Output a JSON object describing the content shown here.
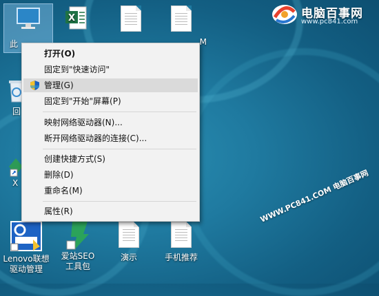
{
  "desktop": {
    "icons": [
      {
        "label": "此"
      },
      {
        "label": ""
      },
      {
        "label": ""
      },
      {
        "label": ""
      },
      {
        "label": "M"
      },
      {
        "label": "回"
      },
      {
        "label": "X"
      },
      {
        "label": "Lenovo联想驱动管理"
      },
      {
        "label": "爱站SEO工具包"
      },
      {
        "label": "演示"
      },
      {
        "label": "手机推荐"
      }
    ]
  },
  "context_menu": {
    "items": [
      {
        "label": "打开(O)",
        "bold": true
      },
      {
        "label": "固定到\"快速访问\""
      },
      {
        "label": "管理(G)",
        "icon": "shield-icon",
        "highlighted": true
      },
      {
        "label": "固定到\"开始\"屏幕(P)"
      },
      {
        "label": "映射网络驱动器(N)..."
      },
      {
        "label": "断开网络驱动器的连接(C)..."
      },
      {
        "label": "创建快捷方式(S)"
      },
      {
        "label": "删除(D)"
      },
      {
        "label": "重命名(M)"
      },
      {
        "label": "属性(R)"
      }
    ]
  },
  "brand": {
    "title": "电脑百事网",
    "url": "www.pc841.com",
    "watermark": "WWW.PC841.COM 电脑百事网"
  },
  "colors": {
    "menu_bg": "#f2f2f2",
    "menu_hover": "#dadada",
    "desktop": "#1f7aa0"
  }
}
